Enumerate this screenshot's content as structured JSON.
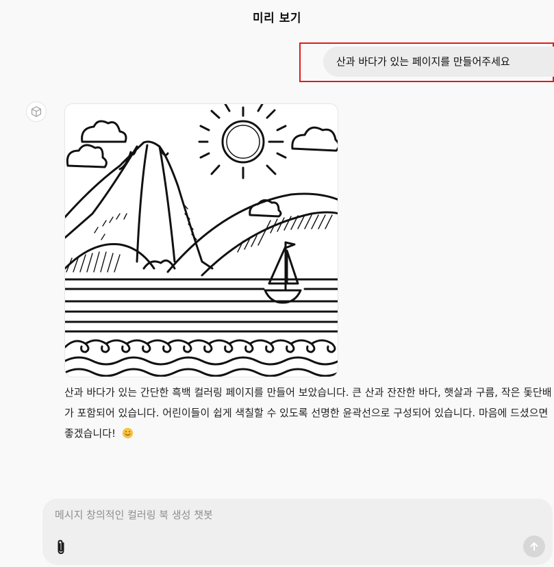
{
  "header": {
    "title": "미리 보기"
  },
  "user_message": {
    "text": "산과 바다가 있는 페이지를 만들어주세요"
  },
  "assistant": {
    "avatar_icon": "cube-icon",
    "image": {
      "description_icon": "coloring-page-mountain-sea",
      "elements": [
        "mountain",
        "sun",
        "clouds",
        "sailboat",
        "sea",
        "waves"
      ]
    },
    "text": "산과 바다가 있는 간단한 흑백 컬러링 페이지를 만들어 보았습니다. 큰 산과 잔잔한 바다, 햇살과 구름, 작은 돛단배가 포함되어 있습니다. 어린이들이 쉽게 색칠할 수 있도록 선명한 윤곽선으로 구성되어 있습니다. 마음에 드셨으면 좋겠습니다!",
    "emoji": "😊"
  },
  "composer": {
    "placeholder": "메시지 창의적인 컬러링 북 생성 챗봇",
    "value": "",
    "attach_icon": "paperclip-icon",
    "send_icon": "arrow-up-icon"
  },
  "colors": {
    "background": "#f9f9f9",
    "user_bubble": "#ececec",
    "highlight_border": "#e01a1a",
    "composer_bg": "#efefef",
    "send_disabled": "#d7d7d7"
  }
}
